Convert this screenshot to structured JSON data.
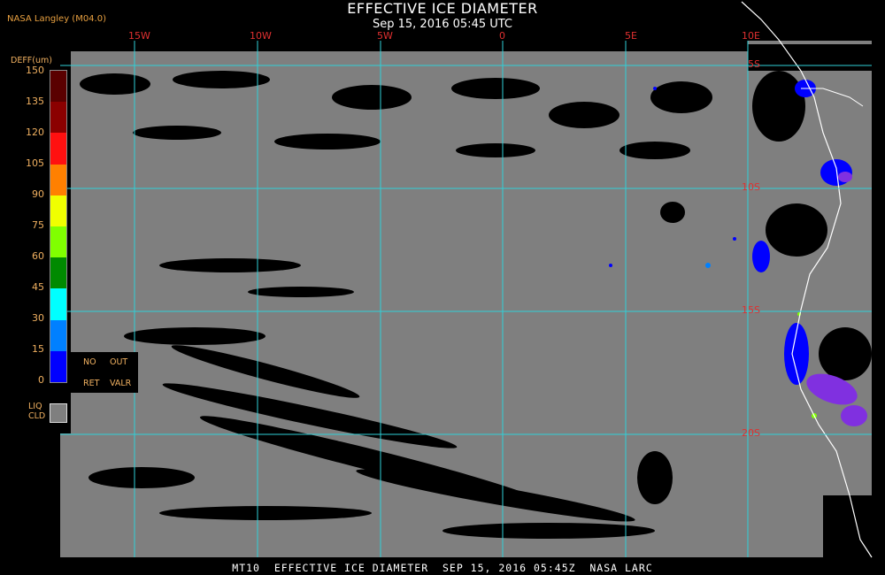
{
  "header": {
    "title": "EFFECTIVE ICE DIAMETER",
    "subtitle": "Sep 15, 2016 05:45 UTC",
    "provider": "NASA Langley (M04.0)"
  },
  "footer": {
    "caption": "MT10  EFFECTIVE ICE DIAMETER  SEP 15, 2016 05:45Z  NASA LARC"
  },
  "map": {
    "longitude_labels": [
      "15W",
      "10W",
      "5W",
      "0",
      "5E",
      "10E"
    ],
    "latitude_labels": [
      "5S",
      "10S",
      "15S",
      "20S"
    ],
    "background_color": "#7f7f7f",
    "grid_color": "#2fd0d8",
    "label_color": "#e03030",
    "coastline_color": "#ffffff"
  },
  "colorbar": {
    "title": "DEFF(um)",
    "ticks": [
      "150",
      "135",
      "120",
      "105",
      "90",
      "75",
      "60",
      "45",
      "30",
      "15",
      "0"
    ],
    "colors": [
      "#5a0000",
      "#8b0000",
      "#ff1010",
      "#ff8000",
      "#f0ff00",
      "#80ff00",
      "#008a00",
      "#00ffff",
      "#0080ff",
      "#0000ff",
      "#8030e0"
    ]
  },
  "legend": {
    "no_ret_line1": "NO",
    "no_ret_line2": "RET",
    "out_valr_line1": "OUT",
    "out_valr_line2": "VALR",
    "liq_line1": "LIQ",
    "liq_line2": "CLD",
    "liq_color": "#7f7f7f"
  }
}
